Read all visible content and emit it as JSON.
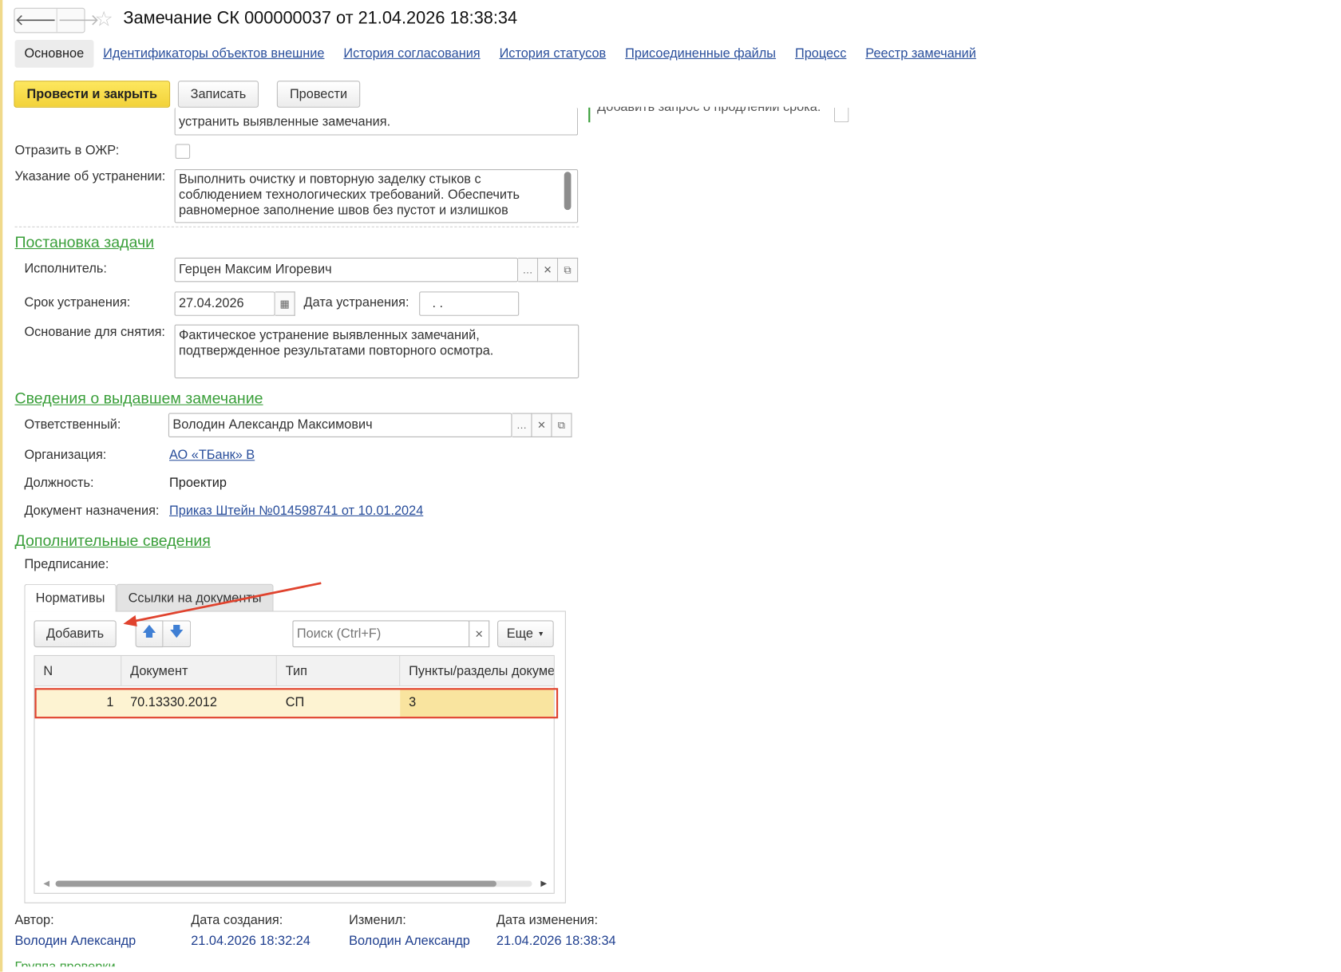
{
  "window": {
    "title": "Замечание СК 000000037 от 21.04.2026 18:38:34",
    "back_glyph": "🡐",
    "forward_glyph": "🡒",
    "star_glyph": "☆"
  },
  "tabs": [
    {
      "label": "Основное"
    },
    {
      "label": "Идентификаторы объектов внешние"
    },
    {
      "label": "История согласования"
    },
    {
      "label": "История статусов"
    },
    {
      "label": "Присоединенные файлы"
    },
    {
      "label": "Процесс"
    },
    {
      "label": "Реестр замечаний"
    }
  ],
  "toolbar": {
    "post_close": "Провести и закрыть",
    "save": "Записать",
    "post": "Провести"
  },
  "top": {
    "remark_tail": "устранить выявленные замечания.",
    "right_cut_text": "Добавить запрос о продлении срока:"
  },
  "ozhr": {
    "label": "Отразить в ОЖР:"
  },
  "instruction": {
    "label": "Указание об устранении:",
    "line1": "Выполнить очистку и повторную заделку стыков с",
    "line2": "соблюдением технологических требований. Обеспечить",
    "line3": "равномерное заполнение швов без пустот и излишков"
  },
  "task": {
    "section": "Постановка задачи",
    "executor_label": "Исполнитель:",
    "executor_value": "Герцен Максим Игоревич",
    "deadline_label": "Срок устранения:",
    "deadline_value": "27.04.2026",
    "fix_date_label": "Дата устранения:",
    "fix_date_value": " .  .",
    "basis_label": "Основание для снятия:",
    "basis_line1": "Фактическое устранение выявленных замечаний,",
    "basis_line2": "подтвержденное результатами повторного осмотра."
  },
  "issuer": {
    "section": "Сведения о выдавшем замечание",
    "responsible_label": "Ответственный:",
    "responsible_value": "Володин Александр Максимович",
    "org_label": "Организация:",
    "org_value": "АО «ТБанк» В",
    "position_label": "Должность:",
    "position_value": "Проектир",
    "doc_label": "Документ назначения:",
    "doc_value": "Приказ Штейн №014598741 от 10.01.2024"
  },
  "extra": {
    "section": "Дополнительные сведения",
    "prescription_label": "Предписание:"
  },
  "inner_tabs": {
    "norms": "Нормативы",
    "doc_links": "Ссылки на документы"
  },
  "table_bar": {
    "add": "Добавить",
    "search_placeholder": "Поиск (Ctrl+F)",
    "more": "Еще"
  },
  "table": {
    "columns": [
      "N",
      "Документ",
      "Тип",
      "Пункты/разделы докуме"
    ],
    "rows": [
      {
        "n": "1",
        "document": "70.13330.2012",
        "type": "СП",
        "sections": "3"
      }
    ]
  },
  "footer": {
    "author_label": "Автор:",
    "author_value": "Володин Александр",
    "created_label": "Дата создания:",
    "created_value": "21.04.2026 18:32:24",
    "changed_by_label": "Изменил:",
    "changed_by_value": "Володин Александр",
    "changed_label": "Дата изменения:",
    "changed_value": "21.04.2026 18:38:34",
    "cut_group": "Группа проверки"
  },
  "colors": {
    "section_green": "#3a9f3a",
    "link_blue": "#2a4f9c",
    "primary_yellow": "#f2d23a",
    "row_highlight": "#fdf3d2",
    "annotation_red": "#e0432e"
  }
}
